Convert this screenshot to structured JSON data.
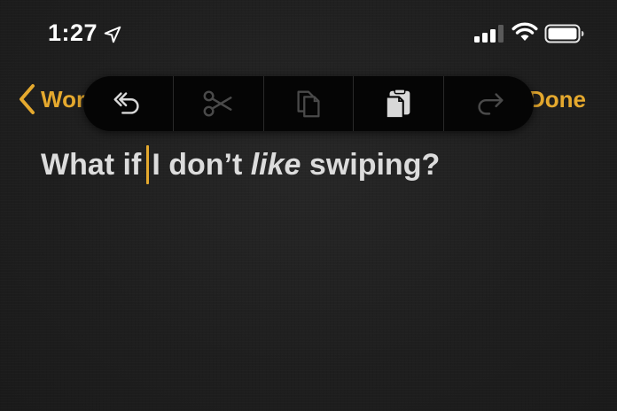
{
  "status_bar": {
    "time": "1:27",
    "icons": [
      "location-arrow-icon",
      "cellular-signal-icon",
      "wifi-icon",
      "battery-icon"
    ]
  },
  "nav": {
    "back_label": "Wor",
    "done_label": "Done"
  },
  "toolbar": {
    "buttons": [
      {
        "name": "undo",
        "icon": "undo-icon",
        "enabled": true
      },
      {
        "name": "cut",
        "icon": "scissors-icon",
        "enabled": false
      },
      {
        "name": "copy",
        "icon": "copy-icon",
        "enabled": false
      },
      {
        "name": "paste",
        "icon": "paste-icon",
        "enabled": true
      },
      {
        "name": "redo",
        "icon": "redo-icon",
        "enabled": false
      }
    ]
  },
  "note": {
    "text_before_cursor": "What if",
    "text_after_cursor_1": "I don’t",
    "text_italic": "like",
    "text_after_italic": "swiping?"
  },
  "colors": {
    "accent": "#e5a92e",
    "background": "#1e1e1e",
    "toolbar": "#050505",
    "text": "#dcdcdc",
    "disabled_icon": "#4a4a4a",
    "enabled_icon": "#d8d8d8"
  }
}
